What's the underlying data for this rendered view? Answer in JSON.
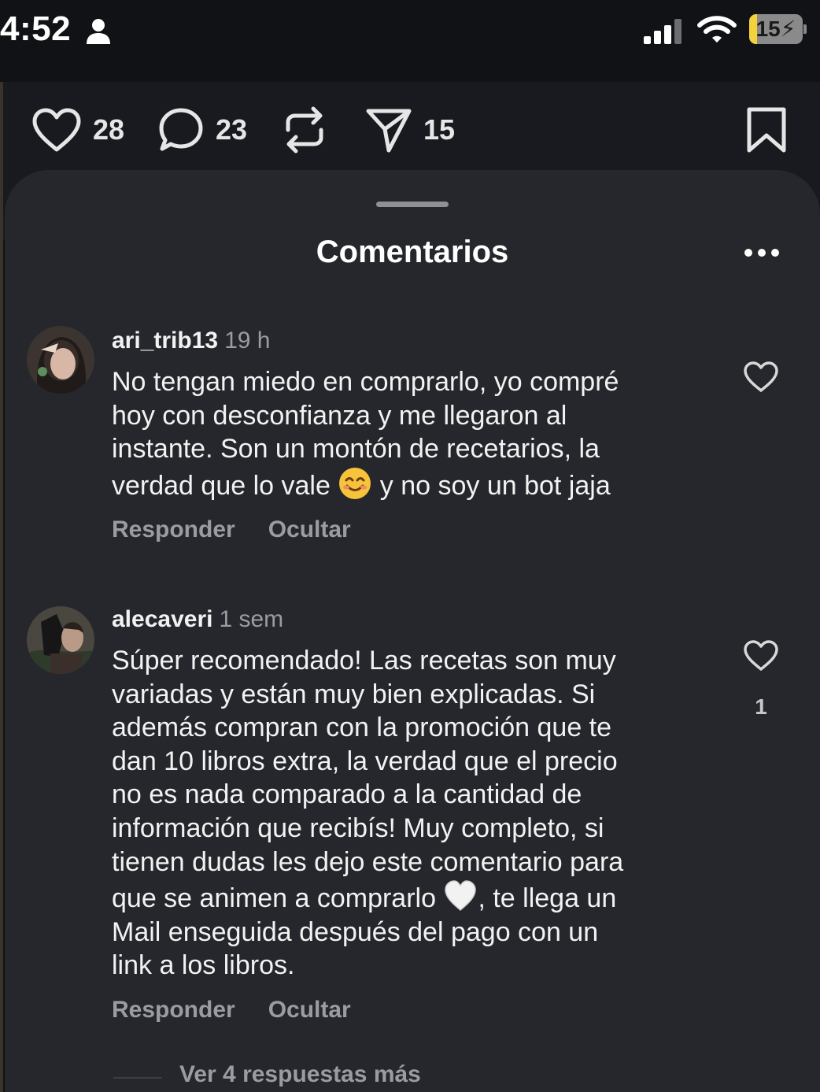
{
  "status_bar": {
    "time": "4:52",
    "battery_level": "15",
    "battery_fraction": 0.15,
    "icons": [
      "person-icon",
      "cellular-signal-icon",
      "wifi-icon",
      "charging-battery-icon"
    ]
  },
  "post_actions": {
    "likes": "28",
    "comments": "23",
    "shares": "15",
    "icons": [
      "heart-icon",
      "comment-bubble-icon",
      "repost-icon",
      "share-send-icon",
      "bookmark-icon"
    ]
  },
  "sheet": {
    "title": "Comentarios",
    "more_icon": "more-horizontal-icon"
  },
  "comments": [
    {
      "username": "ari_trib13",
      "time": "19 h",
      "text_before_emoji": "No tengan miedo en comprarlo, yo compré\nhoy con desconfianza y me llegaron al\ninstante. Son un montón de recetarios, la\nverdad que lo vale ",
      "emoji": "smiling-face-emoji",
      "text_after_emoji": " y no soy un bot jaja",
      "reply_label": "Responder",
      "hide_label": "Ocultar",
      "like_count": ""
    },
    {
      "username": "alecaveri",
      "time": "1 sem",
      "text_before_emoji": "Súper recomendado! Las recetas son muy\nvariadas y están muy bien explicadas. Si\nademás compran con la promoción que te\ndan 10 libros extra, la verdad que el precio\nno es nada comparado a la cantidad de\ninformación que recibís! Muy completo, si\ntienen dudas les dejo este comentario para\nque se animen a comprarlo ",
      "emoji": "white-heart-emoji",
      "text_after_emoji": ", te llega un\nMail enseguida después del pago con un\nlink a los libros.",
      "reply_label": "Responder",
      "hide_label": "Ocultar",
      "like_count": "1",
      "view_replies": "Ver 4 respuestas más"
    }
  ],
  "colors": {
    "background": "#101216",
    "sheet": "#25272c",
    "muted_text": "#9a9ca1",
    "battery_fill": "#f3d23a"
  }
}
